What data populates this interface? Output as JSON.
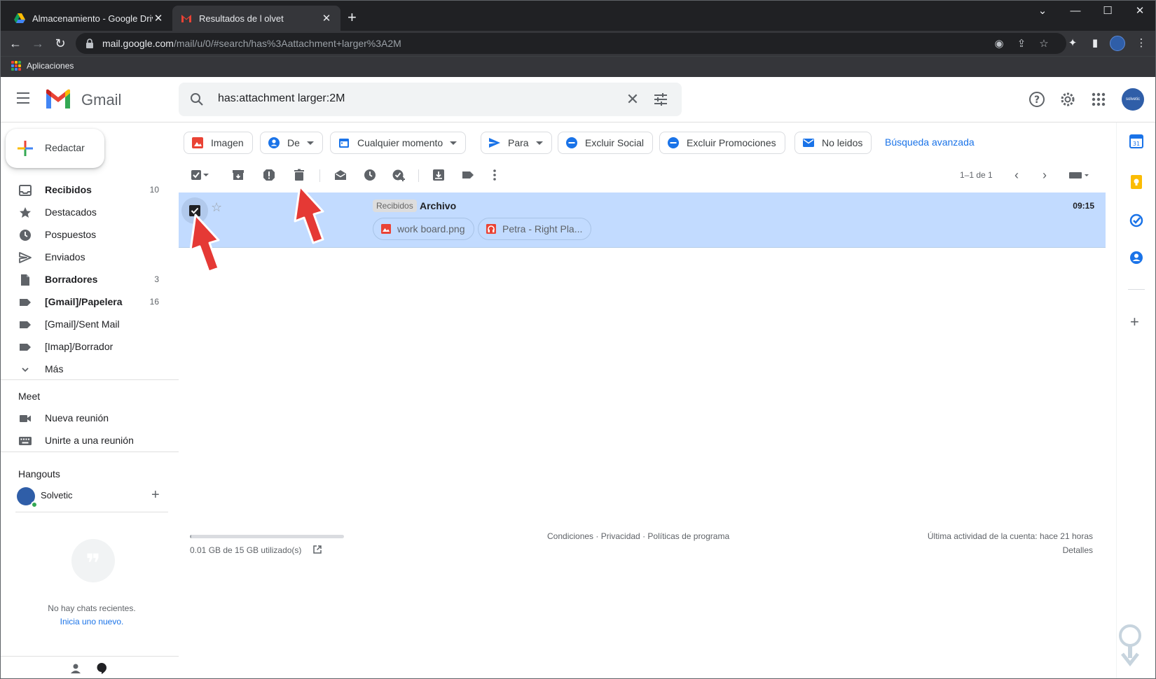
{
  "browser": {
    "tabs": [
      {
        "title": "Almacenamiento - Google Drive",
        "icon": "google-drive-icon",
        "active": false
      },
      {
        "title": "Resultados de l                  olvet",
        "icon": "gmail-icon",
        "active": true
      }
    ],
    "url_host": "mail.google.com",
    "url_path": "/mail/u/0/#search/has%3Aattachment+larger%3A2M",
    "bookmarks": [
      {
        "label": "Aplicaciones",
        "icon": "apps-grid-icon"
      }
    ]
  },
  "header": {
    "app_name": "Gmail",
    "search_query": "has:attachment larger:2M",
    "avatar_text": "solvetic"
  },
  "compose": {
    "label": "Redactar"
  },
  "sidebar": {
    "items": [
      {
        "label": "Recibidos",
        "count": "10",
        "icon": "inbox-icon",
        "bold": true
      },
      {
        "label": "Destacados",
        "count": "",
        "icon": "star-icon",
        "bold": false
      },
      {
        "label": "Pospuestos",
        "count": "",
        "icon": "clock-icon",
        "bold": false
      },
      {
        "label": "Enviados",
        "count": "",
        "icon": "send-icon",
        "bold": false
      },
      {
        "label": "Borradores",
        "count": "3",
        "icon": "draft-icon",
        "bold": true
      },
      {
        "label": "[Gmail]/Papelera",
        "count": "16",
        "icon": "label-icon",
        "bold": true
      },
      {
        "label": "[Gmail]/Sent Mail",
        "count": "",
        "icon": "label-icon",
        "bold": false
      },
      {
        "label": "[Imap]/Borrador",
        "count": "",
        "icon": "label-icon",
        "bold": false
      },
      {
        "label": "Más",
        "count": "",
        "icon": "chevron-down-icon",
        "bold": false
      }
    ],
    "meet": {
      "title": "Meet",
      "items": [
        {
          "label": "Nueva reunión",
          "icon": "video-icon"
        },
        {
          "label": "Unirte a una reunión",
          "icon": "keyboard-icon"
        }
      ]
    },
    "hangouts": {
      "title": "Hangouts",
      "user": "Solvetic",
      "no_chats": "No hay chats recientes.",
      "start_new": "Inicia uno nuevo."
    }
  },
  "filters": {
    "chips": [
      {
        "label": "Imagen",
        "icon": "image-icon",
        "dropdown": false
      },
      {
        "label": "De",
        "icon": "person-icon",
        "dropdown": true
      },
      {
        "label": "Cualquier momento",
        "icon": "calendar-icon",
        "dropdown": true
      },
      {
        "label": "Para",
        "icon": "send-icon",
        "dropdown": true
      },
      {
        "label": "Excluir Social",
        "icon": "minus-circle-icon",
        "dropdown": false
      },
      {
        "label": "Excluir Promociones",
        "icon": "minus-circle-icon",
        "dropdown": false
      },
      {
        "label": "No leidos",
        "icon": "mail-icon",
        "dropdown": false
      }
    ],
    "advanced_link": "Búsqueda avanzada"
  },
  "actions": {
    "pager": "1–1 de 1"
  },
  "messages": [
    {
      "label": "Recibidos",
      "subject": "Archivo",
      "time": "09:15",
      "selected": true,
      "attachments": [
        {
          "name": "work board.png",
          "icon": "image-icon"
        },
        {
          "name": "Petra - Right Pla...",
          "icon": "audio-icon"
        }
      ]
    }
  ],
  "footer": {
    "storage": "0.01 GB de 15 GB utilizado(s)",
    "storage_fraction": 0.001,
    "links": "Condiciones · Privacidad · Políticas de programa",
    "activity": "Última actividad de la cuenta: hace 21 horas",
    "details": "Detalles"
  },
  "colors": {
    "selected_row": "#c2dbff",
    "accent": "#1a73e8",
    "arrow": "#e53935"
  }
}
